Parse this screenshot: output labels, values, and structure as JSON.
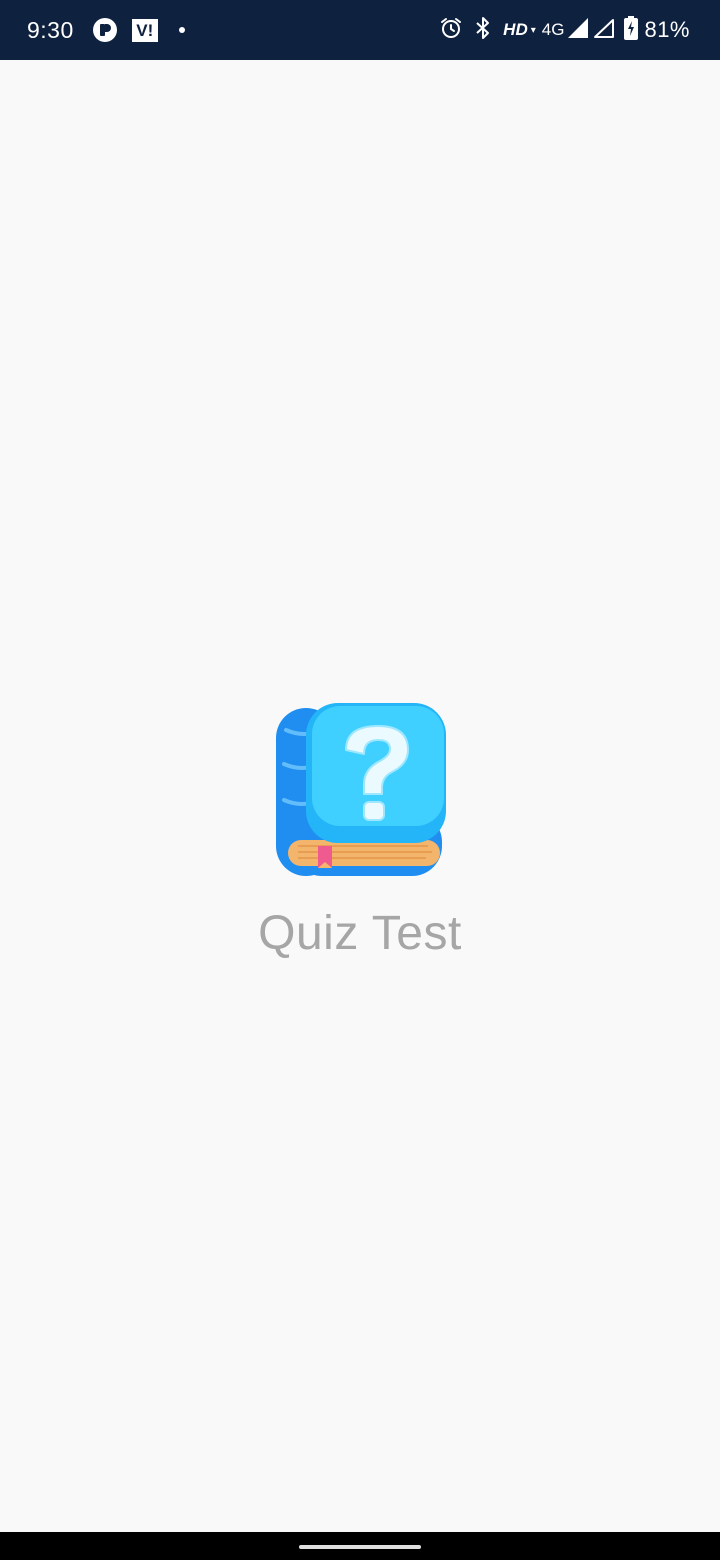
{
  "status_bar": {
    "time": "9:30",
    "carrier_badge": "V!",
    "hd_label": "HD",
    "hd_arrow": "▾",
    "network_type": "4G",
    "battery_percent": "81%",
    "icons": [
      "app-notification-icon",
      "vi-carrier-icon",
      "alarm-icon",
      "bluetooth-icon",
      "signal-icon",
      "signal-empty-icon",
      "battery-charging-icon"
    ]
  },
  "splash": {
    "app_name": "Quiz Test",
    "logo_icon": "quiz-book-question-icon",
    "colors": {
      "logo_primary": "#2aa8f4",
      "logo_accent": "#4fd3ff",
      "app_name_text": "#a6a6a6",
      "background": "#f9f9f9"
    }
  }
}
